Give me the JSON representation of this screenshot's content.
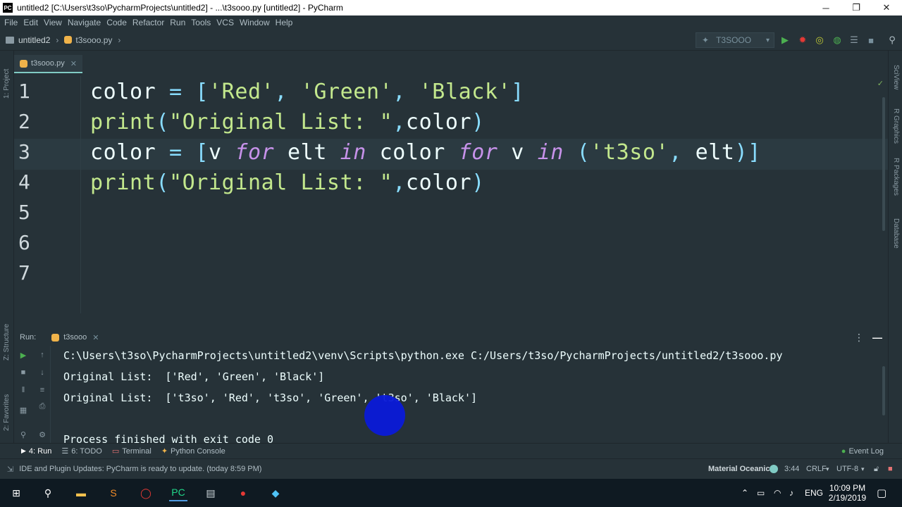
{
  "window": {
    "title": "untitled2 [C:\\Users\\t3so\\PycharmProjects\\untitled2] - ...\\t3sooo.py [untitled2] - PyCharm",
    "logo": "PC",
    "minimize": "─",
    "restore": "❐",
    "close": "✕"
  },
  "menu": [
    "File",
    "Edit",
    "View",
    "Navigate",
    "Code",
    "Refactor",
    "Run",
    "Tools",
    "VCS",
    "Window",
    "Help"
  ],
  "nav": {
    "project": "untitled2",
    "file": "t3sooo.py",
    "run_config": "T3SOOO"
  },
  "left_strip": {
    "project": "1: Project",
    "structure": "Z: Structure",
    "favorites": "2: Favorites"
  },
  "right_strip": {
    "sciview": "SciView",
    "r_graphics": "R Graphics",
    "r_packages": "R Packages",
    "database": "Database"
  },
  "tabs": [
    {
      "label": "t3sooo.py"
    }
  ],
  "editor": {
    "line_numbers": [
      "1",
      "2",
      "3",
      "4",
      "5",
      "6",
      "7"
    ],
    "lines": [
      "color = ['Red', 'Green', 'Black']",
      "print(\"Original List: \",color)",
      "color = [v for elt in color for v in ('t3so', elt)]",
      "print(\"Original List: \",color)"
    ]
  },
  "run_panel": {
    "label": "Run:",
    "tab": "t3sooo",
    "output": [
      "C:\\Users\\t3so\\PycharmProjects\\untitled2\\venv\\Scripts\\python.exe C:/Users/t3so/PycharmProjects/untitled2/t3sooo.py",
      "Original List:  ['Red', 'Green', 'Black']",
      "Original List:  ['t3so', 'Red', 't3so', 'Green', 't3so', 'Black']",
      "",
      "Process finished with exit code 0"
    ]
  },
  "tool_tabs": [
    {
      "label": "4: Run",
      "icon": "play-icon"
    },
    {
      "label": "6: TODO",
      "icon": "list-icon"
    },
    {
      "label": "Terminal",
      "icon": "terminal-icon"
    },
    {
      "label": "Python Console",
      "icon": "python-icon"
    }
  ],
  "event_log": "Event Log",
  "status": {
    "message": "IDE and Plugin Updates: PyCharm is ready to update. (today 8:59 PM)",
    "theme": "Material Oceanic",
    "position": "3:44",
    "line_sep": "CRLF",
    "encoding": "UTF-8"
  },
  "taskbar": {
    "lang": "ENG",
    "time": "10:09 PM",
    "date": "2/19/2019"
  },
  "colors": {
    "background": "#263238",
    "accent": "#80cbc4",
    "string": "#c3e88d",
    "keyword": "#c792ea",
    "punctuation": "#89ddff"
  }
}
